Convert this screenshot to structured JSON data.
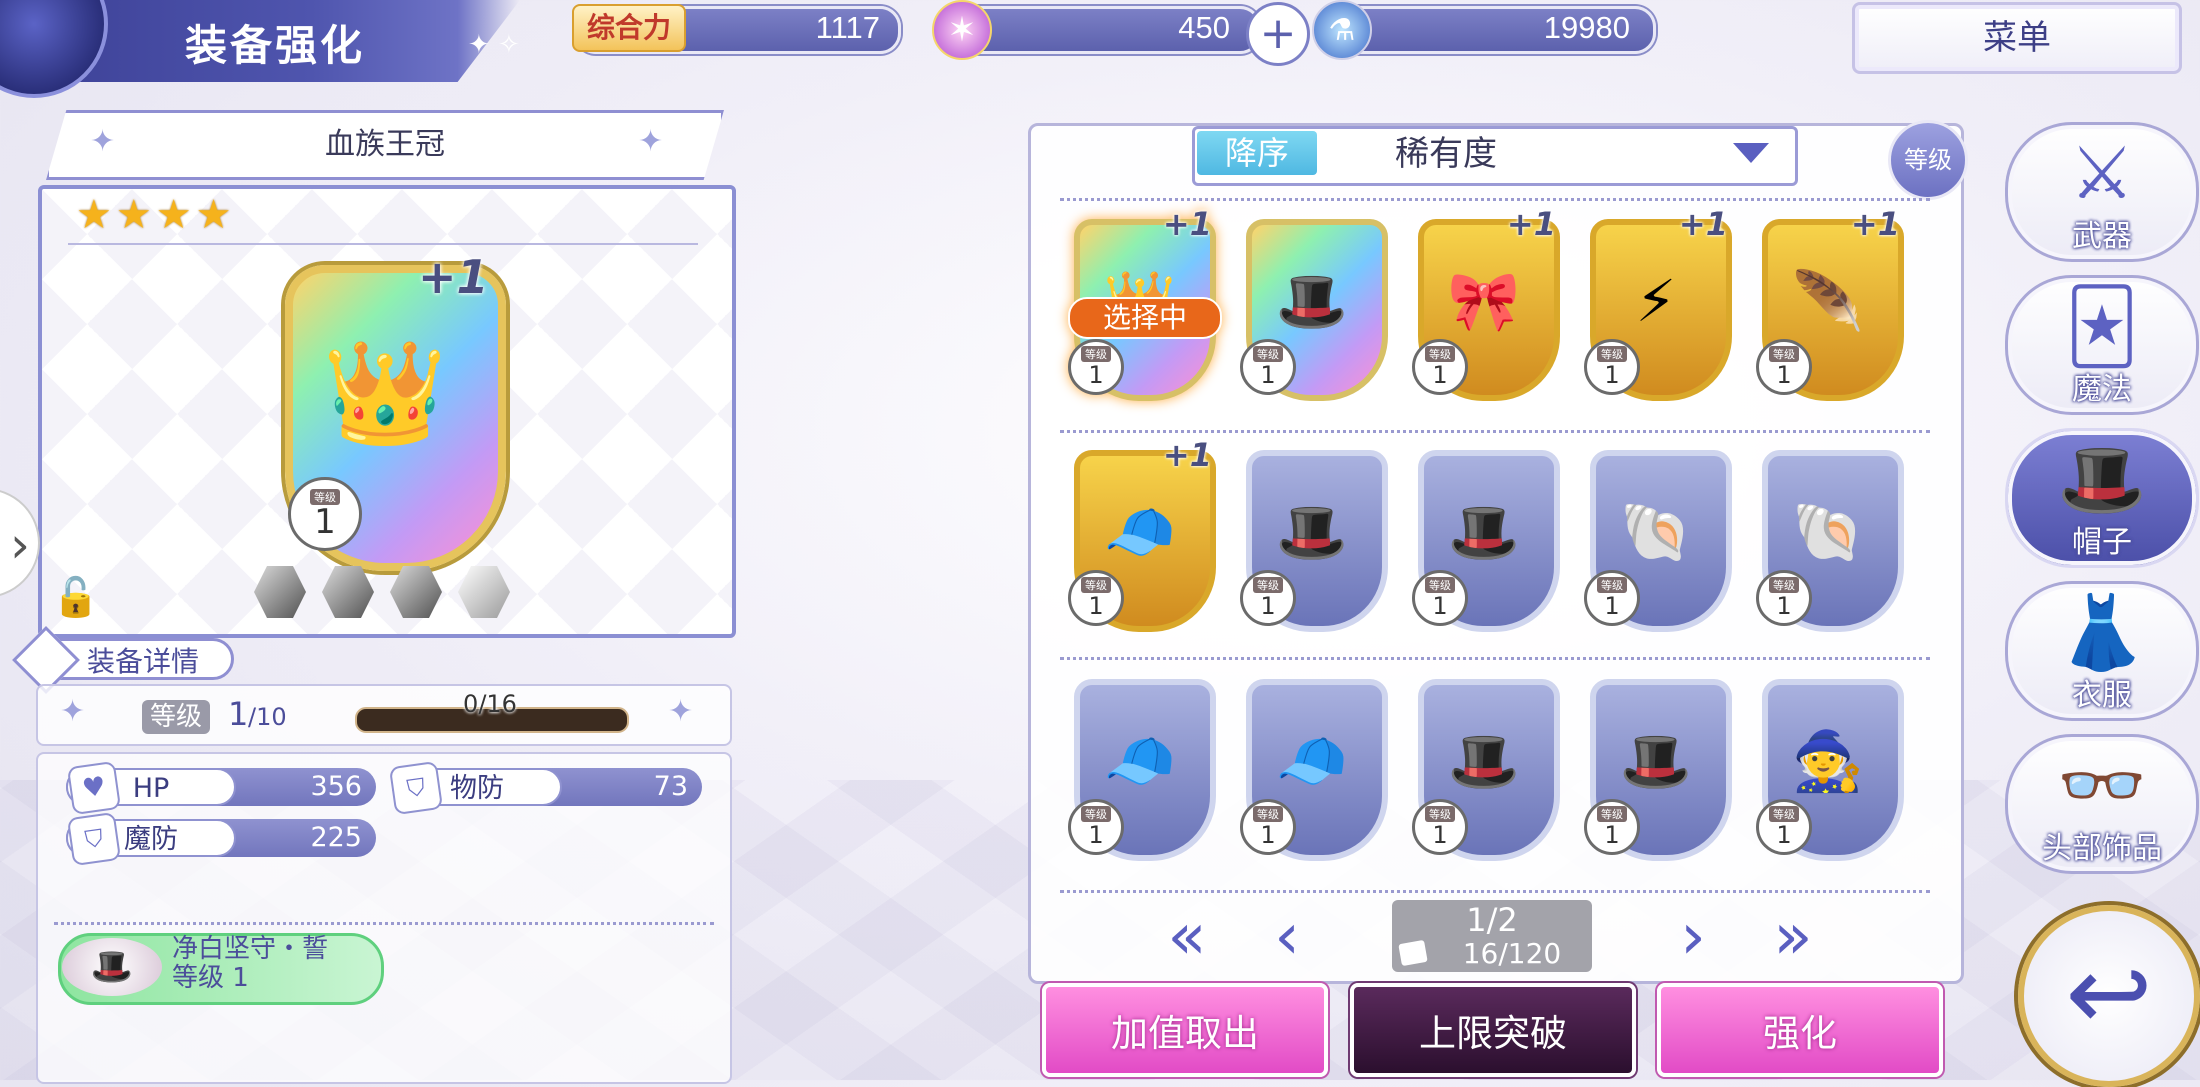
{
  "header": {
    "title": "装备强化",
    "power_label": "综合力",
    "power_value": "1117",
    "gem_value": "450",
    "potion_value": "19980",
    "menu_label": "菜单"
  },
  "equipment": {
    "name": "血族王冠",
    "stars": 4,
    "plus": "+1",
    "level_label": "等级",
    "level": "1",
    "detail_tab": "装备详情",
    "level_row_label": "等级",
    "level_current": "1",
    "level_max": "/10",
    "xp_text": "0/16",
    "xp_fraction": 0,
    "stats": [
      {
        "name": "HP",
        "value": "356"
      },
      {
        "name": "物防",
        "value": "73"
      },
      {
        "name": "魔防",
        "value": "225"
      }
    ],
    "skill_name": "净白坚守・誓",
    "skill_level": "等级 1"
  },
  "sort": {
    "order_label": "降序",
    "key_label": "稀有度",
    "filter_label": "等级"
  },
  "grid": {
    "selected_label": "选择中",
    "items": [
      {
        "frame": "rainbow",
        "plus": "+1",
        "level_label": "等级",
        "level": "1",
        "glyph": "👑",
        "icon": "vampire-crown-icon",
        "selected": true
      },
      {
        "frame": "rainbow",
        "plus": "",
        "level_label": "等级",
        "level": "1",
        "glyph": "🎩",
        "icon": "white-cap-icon",
        "selected": false
      },
      {
        "frame": "gold",
        "plus": "+1",
        "level_label": "等级",
        "level": "1",
        "glyph": "🎀",
        "icon": "red-feathers-icon",
        "selected": false
      },
      {
        "frame": "gold",
        "plus": "+1",
        "level_label": "等级",
        "level": "1",
        "glyph": "⚡",
        "icon": "golden-ornament-icon",
        "selected": false
      },
      {
        "frame": "gold",
        "plus": "+1",
        "level_label": "等级",
        "level": "1",
        "glyph": "🪶",
        "icon": "feather-hairpin-icon",
        "selected": false
      },
      {
        "frame": "gold",
        "plus": "+1",
        "level_label": "等级",
        "level": "1",
        "glyph": "🧢",
        "icon": "blue-police-cap-icon",
        "selected": false
      },
      {
        "frame": "blue",
        "plus": "",
        "level_label": "等级",
        "level": "1",
        "glyph": "🎩",
        "icon": "white-sailor-cap-icon",
        "selected": false
      },
      {
        "frame": "blue",
        "plus": "",
        "level_label": "等级",
        "level": "1",
        "glyph": "🎩",
        "icon": "white-sailor-cap-icon",
        "selected": false
      },
      {
        "frame": "blue",
        "plus": "",
        "level_label": "等级",
        "level": "1",
        "glyph": "🐚",
        "icon": "shell-headpiece-icon",
        "selected": false
      },
      {
        "frame": "blue",
        "plus": "",
        "level_label": "等级",
        "level": "1",
        "glyph": "🐚",
        "icon": "shell-headpiece-icon",
        "selected": false
      },
      {
        "frame": "blue",
        "plus": "",
        "level_label": "等级",
        "level": "1",
        "glyph": "🧢",
        "icon": "teal-beret-icon",
        "selected": false
      },
      {
        "frame": "blue",
        "plus": "",
        "level_label": "等级",
        "level": "1",
        "glyph": "🧢",
        "icon": "teal-beret-icon",
        "selected": false
      },
      {
        "frame": "blue",
        "plus": "",
        "level_label": "等级",
        "level": "1",
        "glyph": "🎩",
        "icon": "black-top-hat-icon",
        "selected": false
      },
      {
        "frame": "blue",
        "plus": "",
        "level_label": "等级",
        "level": "1",
        "glyph": "🎩",
        "icon": "black-top-hat-icon",
        "selected": false
      },
      {
        "frame": "blue",
        "plus": "",
        "level_label": "等级",
        "level": "1",
        "glyph": "🧙",
        "icon": "witch-hat-icon",
        "selected": false
      }
    ]
  },
  "pager": {
    "page": "1/2",
    "count": "16/120"
  },
  "actions": {
    "extract": "加值取出",
    "limit_break": "上限突破",
    "enhance": "强化"
  },
  "categories": [
    {
      "label": "武器",
      "glyph": "⚔",
      "icon": "weapon-icon",
      "active": false
    },
    {
      "label": "魔法",
      "glyph": "🃏",
      "icon": "magic-card-icon",
      "active": false
    },
    {
      "label": "帽子",
      "glyph": "🎩",
      "icon": "hat-icon",
      "active": true
    },
    {
      "label": "衣服",
      "glyph": "👗",
      "icon": "clothes-icon",
      "active": false
    },
    {
      "label": "头部饰品",
      "glyph": "👓",
      "icon": "glasses-icon",
      "active": false
    }
  ],
  "colors": {
    "accent": "#5a5fc0",
    "selected": "#e8671a",
    "action_pink": "#e24bc6",
    "action_dark": "#2b0f2e"
  }
}
